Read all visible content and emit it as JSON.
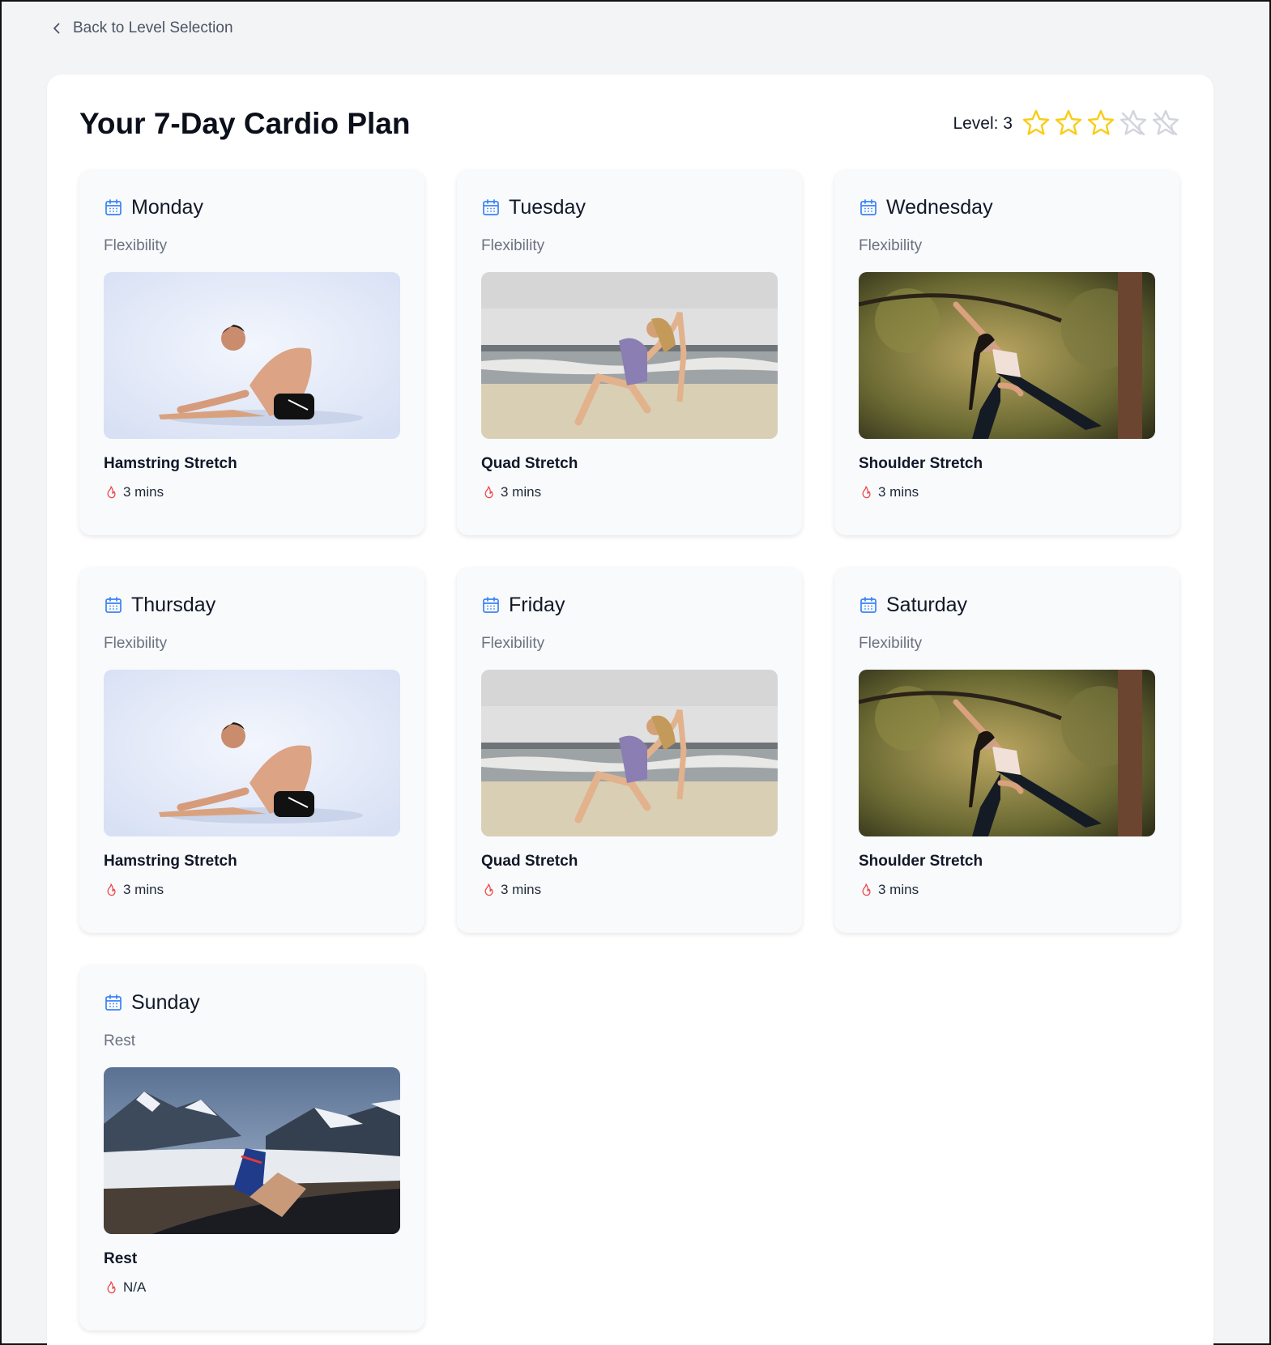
{
  "nav": {
    "back_label": "Back to Level Selection"
  },
  "header": {
    "title": "Your 7-Day Cardio Plan",
    "level_label": "Level: 3",
    "level_value": 3,
    "level_max": 5
  },
  "colors": {
    "star_filled": "#facc15",
    "star_empty": "#d1d5db",
    "calendar": "#3b82f6",
    "flame": "#ef4444"
  },
  "days": [
    {
      "day": "Monday",
      "category": "Flexibility",
      "exercise": "Hamstring Stretch",
      "duration": "3 mins",
      "image": "hamstring"
    },
    {
      "day": "Tuesday",
      "category": "Flexibility",
      "exercise": "Quad Stretch",
      "duration": "3 mins",
      "image": "quad"
    },
    {
      "day": "Wednesday",
      "category": "Flexibility",
      "exercise": "Shoulder Stretch",
      "duration": "3 mins",
      "image": "shoulder"
    },
    {
      "day": "Thursday",
      "category": "Flexibility",
      "exercise": "Hamstring Stretch",
      "duration": "3 mins",
      "image": "hamstring"
    },
    {
      "day": "Friday",
      "category": "Flexibility",
      "exercise": "Quad Stretch",
      "duration": "3 mins",
      "image": "quad"
    },
    {
      "day": "Saturday",
      "category": "Flexibility",
      "exercise": "Shoulder Stretch",
      "duration": "3 mins",
      "image": "shoulder"
    },
    {
      "day": "Sunday",
      "category": "Rest",
      "exercise": "Rest",
      "duration": "N/A",
      "image": "rest"
    }
  ]
}
